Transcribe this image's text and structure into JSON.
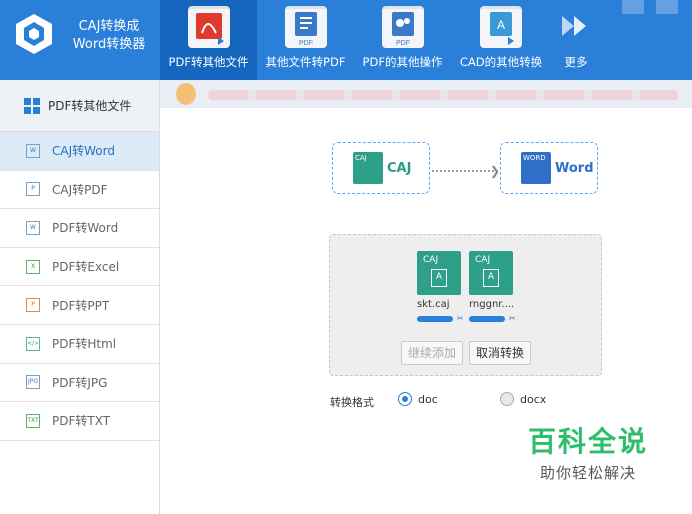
{
  "app": {
    "title_line1": "CAJ转换成",
    "title_line2": "Word转换器"
  },
  "nav": {
    "items": [
      {
        "label": "PDF转其他文件",
        "icon": "pdf-acrobat-icon",
        "active": true
      },
      {
        "label": "其他文件转PDF",
        "icon": "document-to-pdf-icon",
        "active": false
      },
      {
        "label": "PDF的其他操作",
        "icon": "pdf-gears-icon",
        "active": false
      },
      {
        "label": "CAD的其他转换",
        "icon": "cad-document-icon",
        "active": false
      },
      {
        "label": "更多",
        "icon": "double-chevron-right-icon",
        "active": false
      }
    ]
  },
  "sidebar": {
    "header": "PDF转其他文件",
    "items": [
      {
        "label": "CAJ转Word",
        "active": true
      },
      {
        "label": "CAJ转PDF",
        "active": false
      },
      {
        "label": "PDF转Word",
        "active": false
      },
      {
        "label": "PDF转Excel",
        "active": false
      },
      {
        "label": "PDF转PPT",
        "active": false
      },
      {
        "label": "PDF转Html",
        "active": false
      },
      {
        "label": "PDF转JPG",
        "active": false
      },
      {
        "label": "PDF转TXT",
        "active": false
      }
    ]
  },
  "flow": {
    "source_label": "CAJ",
    "source_tag": "CAJ",
    "target_label": "Word",
    "target_tag": "WORD"
  },
  "files": [
    {
      "name": "skt.caj",
      "tag": "CAJ",
      "letter": "A"
    },
    {
      "name": "rnggnr....",
      "tag": "CAJ",
      "letter": "A"
    }
  ],
  "buttons": {
    "continue_add": "继续添加",
    "cancel_convert": "取消转换"
  },
  "format": {
    "label": "转换格式",
    "options": [
      {
        "label": "doc",
        "selected": true
      },
      {
        "label": "docx",
        "selected": false
      }
    ]
  },
  "watermark": {
    "main": "百科全说",
    "sub": "助你轻松解决"
  },
  "colors": {
    "header_bg": "#2a7fd8",
    "active_nav": "#1565bf",
    "accent": "#2a7fd8",
    "caj_green": "#2ea08a",
    "word_blue": "#2f6fc9",
    "watermark_green": "#2dbe6c"
  }
}
